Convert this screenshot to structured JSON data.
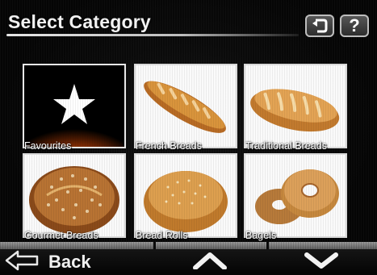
{
  "header": {
    "title": "Select Category",
    "return_icon": "return-arrow-icon",
    "help_label": "?"
  },
  "categories": [
    {
      "label": "Favourites",
      "icon": "star-icon",
      "selected": true
    },
    {
      "label": "French Breads",
      "icon": "baguette-image"
    },
    {
      "label": "Traditional Breads",
      "icon": "loaf-image"
    },
    {
      "label": "Gourmet Breads",
      "icon": "gourmet-bread-image"
    },
    {
      "label": "Bread Rolls",
      "icon": "bread-roll-image"
    },
    {
      "label": "Bagels",
      "icon": "bagel-image"
    }
  ],
  "footer": {
    "back_label": "Back",
    "up_icon": "chevron-up-icon",
    "down_icon": "chevron-down-icon"
  },
  "colors": {
    "background": "#050505",
    "text": "#ffffff",
    "favourite_glow": "#f07a12"
  }
}
